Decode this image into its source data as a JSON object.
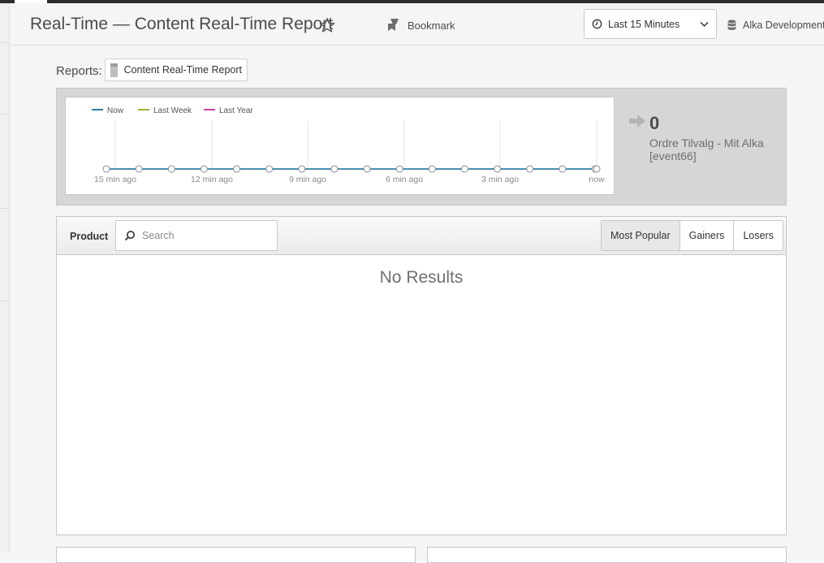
{
  "header": {
    "title": "Real-Time — Content Real-Time Report",
    "bookmark_label": "Bookmark",
    "time_range": "Last 15 Minutes",
    "report_suite": "Alka Development"
  },
  "reports": {
    "label": "Reports:",
    "selected": "Content Real-Time Report"
  },
  "chart_data": {
    "type": "line",
    "legend": [
      "Now",
      "Last Week",
      "Last Year"
    ],
    "legend_colors": [
      "#2e7fa6",
      "#9ab43b",
      "#c742a8"
    ],
    "x_tick_labels": [
      "15 min ago",
      "12 min ago",
      "9 min ago",
      "6 min ago",
      "3 min ago",
      "now"
    ],
    "series": [
      {
        "name": "Now",
        "values": [
          0,
          0,
          0,
          0,
          0,
          0,
          0,
          0,
          0,
          0,
          0,
          0,
          0,
          0,
          0,
          0
        ]
      }
    ],
    "ylim": [
      0,
      1
    ],
    "grid": true
  },
  "metric": {
    "value": "0",
    "name": "Ordre Tilvalg - Mit Alka [event66]"
  },
  "table": {
    "dimension_label": "Product",
    "search_placeholder": "Search",
    "tabs": [
      "Most Popular",
      "Gainers",
      "Losers"
    ],
    "active_tab": "Most Popular",
    "empty_text": "No Results"
  }
}
